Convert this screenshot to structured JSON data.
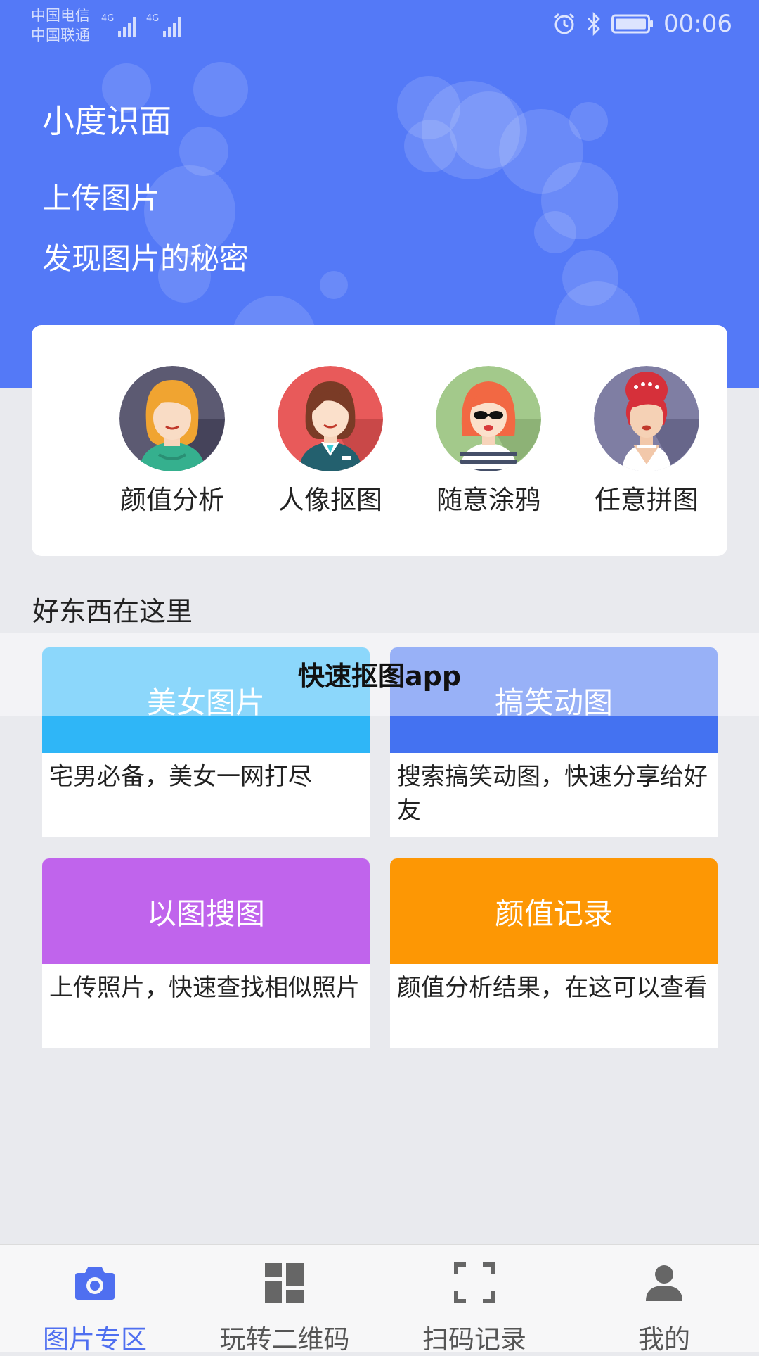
{
  "status_bar": {
    "carrier_1": "中国电信",
    "carrier_2": "中国联通",
    "network_1": "4G",
    "network_2": "4G",
    "time": "00:06"
  },
  "header": {
    "title": "小度识面",
    "line_1": "上传图片",
    "line_2": "发现图片的秘密",
    "background_color": "#5479f7"
  },
  "features": [
    {
      "label": "颜值分析",
      "icon": "woman-blonde-avatar-icon"
    },
    {
      "label": "人像抠图",
      "icon": "woman-suit-avatar-icon"
    },
    {
      "label": "随意涂鸦",
      "icon": "woman-sunglasses-avatar-icon"
    },
    {
      "label": "任意拼图",
      "icon": "woman-updo-avatar-icon"
    }
  ],
  "section_title": "好东西在这里",
  "overlay_text": "快速抠图app",
  "cards": [
    {
      "title": "美女图片",
      "desc": "宅男必备，美女一网打尽",
      "color": "#2fb6f7"
    },
    {
      "title": "搞笑动图",
      "desc": "搜索搞笑动图，快速分享给好友",
      "color": "#4472f1"
    },
    {
      "title": "以图搜图",
      "desc": "上传照片，快速查找相似照片",
      "color": "#c064ec"
    },
    {
      "title": "颜值记录",
      "desc": "颜值分析结果，在这可以查看",
      "color": "#fd9704"
    }
  ],
  "nav": [
    {
      "label": "图片专区",
      "icon": "camera-icon",
      "active": true
    },
    {
      "label": "玩转二维码",
      "icon": "qr-grid-icon",
      "active": false
    },
    {
      "label": "扫码记录",
      "icon": "scan-frame-icon",
      "active": false
    },
    {
      "label": "我的",
      "icon": "person-icon",
      "active": false
    }
  ],
  "colors": {
    "accent": "#4f6ff0",
    "inactive": "#555555"
  }
}
